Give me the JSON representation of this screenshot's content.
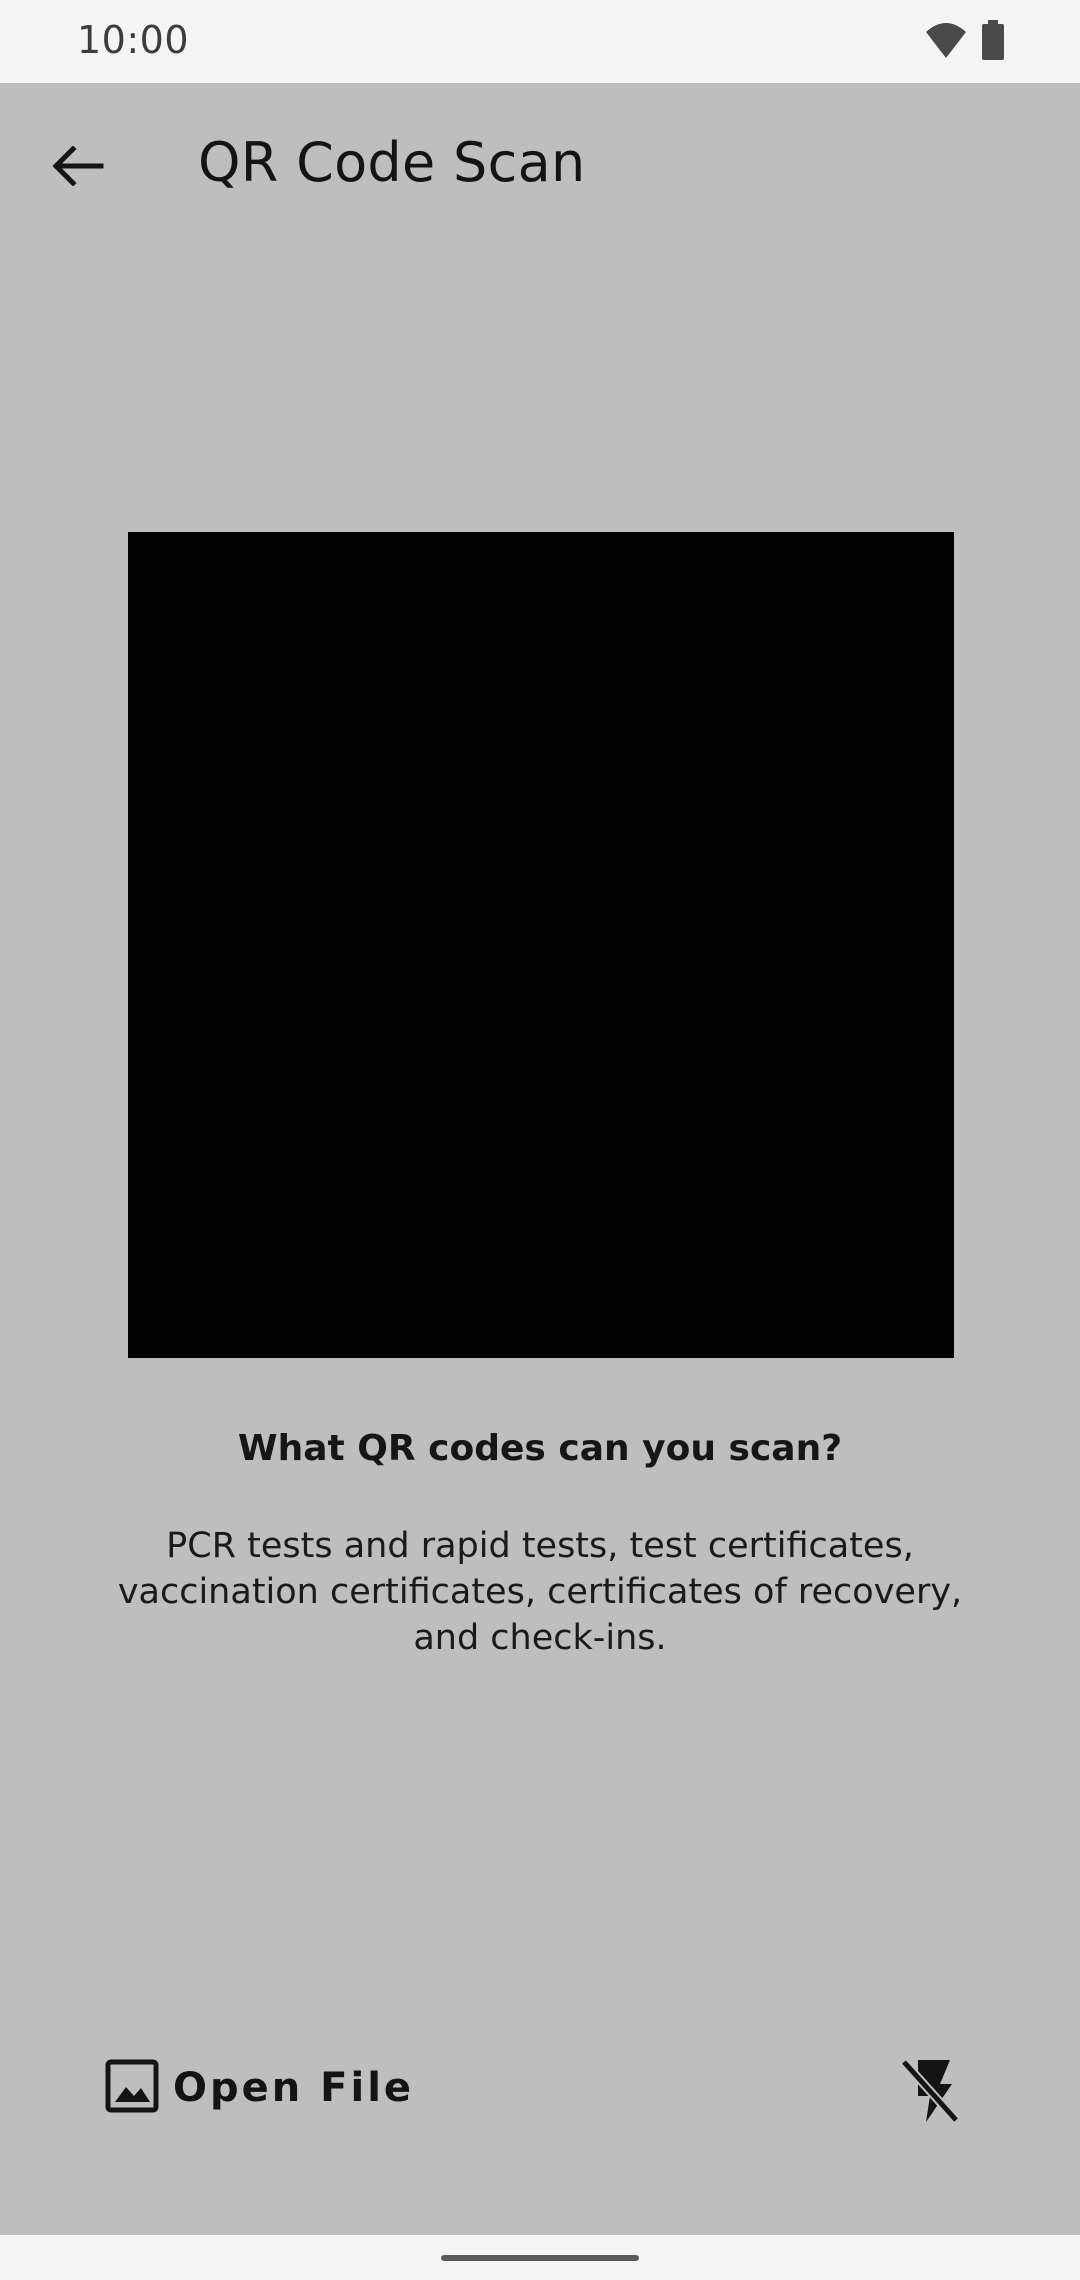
{
  "status_bar": {
    "time": "10:00",
    "icons": [
      "wifi-icon",
      "battery-icon"
    ]
  },
  "toolbar": {
    "back_icon": "arrow-left-icon",
    "title": "QR Code Scan"
  },
  "scanner": {
    "heading": "What QR codes can you scan?",
    "body": "PCR tests and rapid tests, test certificates, vaccination certificates, certificates of recovery, and check-ins."
  },
  "actions": {
    "open_file_icon": "image-icon",
    "open_file_label": "Open File",
    "flash_icon": "flash-off-icon"
  },
  "colors": {
    "app_background": "#bfbebf",
    "system_bar": "#f4f4f4",
    "viewfinder": "#030203",
    "text": "#141414"
  }
}
